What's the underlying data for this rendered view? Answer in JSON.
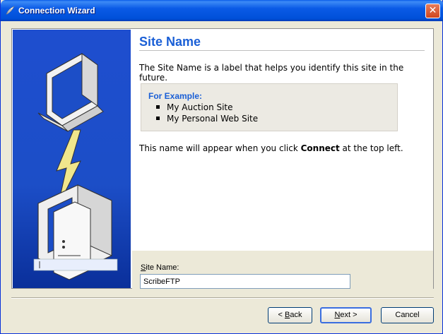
{
  "window": {
    "title": "Connection Wizard",
    "close_glyph": "✕"
  },
  "page": {
    "title": "Site Name",
    "description": "The Site Name is a label that helps you identify this site in the future.",
    "example_heading": "For Example:",
    "examples": [
      "My Auction Site",
      "My Personal Web Site"
    ],
    "note_prefix": "This name will appear when you click ",
    "note_bold": "Connect",
    "note_suffix": " at the top left."
  },
  "field": {
    "label_accel": "S",
    "label_rest": "ite Name:",
    "value": "ScribeFTP"
  },
  "buttons": {
    "back_arrow": "< ",
    "back_accel": "B",
    "back_rest": "ack",
    "next_accel": "N",
    "next_rest": "ext >",
    "cancel": "Cancel"
  },
  "colors": {
    "accent": "#1a5fd6",
    "sidebar": "#1c4ec7"
  },
  "icons": {
    "wizard_illustration": "computer-connection-illustration",
    "app_icon": "feather-icon",
    "close": "close-icon"
  }
}
